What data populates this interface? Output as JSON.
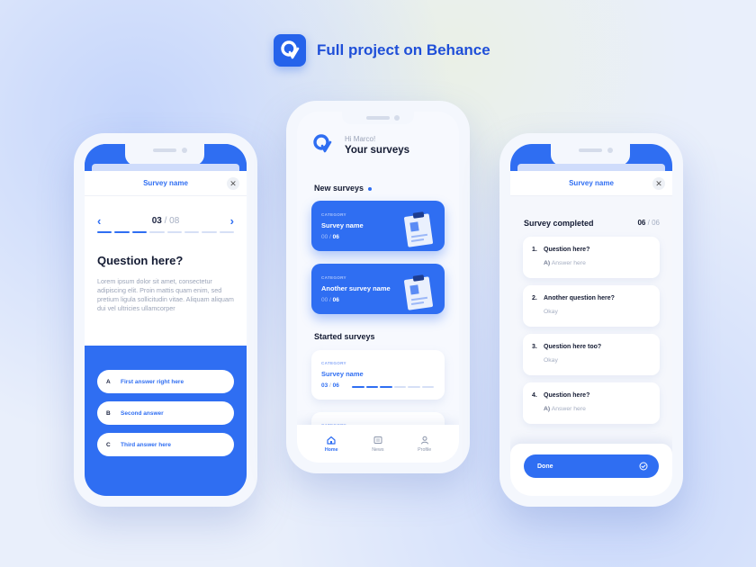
{
  "header": {
    "title": "Full project on Behance",
    "logo_letter": "Q"
  },
  "colors": {
    "accent": "#2f6ef2",
    "brand": "#2563eb",
    "text": "#141b33",
    "muted": "#a5aec2"
  },
  "left_screen": {
    "sheet_title": "Survey name",
    "close_icon": "close-icon",
    "current_page": "03",
    "page_sep": "/",
    "total_pages": "08",
    "progress_steps": 8,
    "progress_done": 3,
    "question_title": "Question here?",
    "question_body": "Lorem ipsum dolor sit amet, consectetur adipiscing elit. Proin mattis quam enim, sed pretium ligula sollicitudin vitae. Aliquam aliquam dui vel ultricies ullamcorper",
    "answers": [
      {
        "letter": "A",
        "text": "First answer right here"
      },
      {
        "letter": "B",
        "text": "Second answer"
      },
      {
        "letter": "C",
        "text": "Third answer here"
      }
    ]
  },
  "middle_screen": {
    "greeting": "Hi Marco!",
    "title": "Your surveys",
    "new_surveys_label": "New surveys",
    "new_surveys": [
      {
        "category": "CATEGORY",
        "name": "Survey name",
        "done": "00",
        "sep": "/",
        "total": "06"
      },
      {
        "category": "CATEGORY",
        "name": "Another survey name",
        "done": "00",
        "sep": "/",
        "total": "06"
      }
    ],
    "started_label": "Started surveys",
    "started_surveys": [
      {
        "category": "CATEGORY",
        "name": "Survey name",
        "done": "03",
        "sep": "/",
        "total": "06",
        "progress": 0.5
      },
      {
        "category": "CATEGORY",
        "name": ""
      }
    ],
    "tabs": [
      {
        "label": "Home",
        "icon": "home-icon",
        "active": true
      },
      {
        "label": "News",
        "icon": "newspaper-icon",
        "active": false
      },
      {
        "label": "Profile",
        "icon": "profile-icon",
        "active": false
      }
    ]
  },
  "right_screen": {
    "sheet_title": "Survey name",
    "completed_label": "Survey completed",
    "done_count": "06",
    "sep": "/",
    "total": "06",
    "questions": [
      {
        "num": "1.",
        "text": "Question here?",
        "prefix": "A)",
        "answer": "Answer here"
      },
      {
        "num": "2.",
        "text": "Another question here?",
        "prefix": "",
        "answer": "Okay"
      },
      {
        "num": "3.",
        "text": "Question here too?",
        "prefix": "",
        "answer": "Okay"
      },
      {
        "num": "4.",
        "text": "Question here?",
        "prefix": "A)",
        "answer": "Answer here"
      }
    ],
    "done_label": "Done"
  }
}
